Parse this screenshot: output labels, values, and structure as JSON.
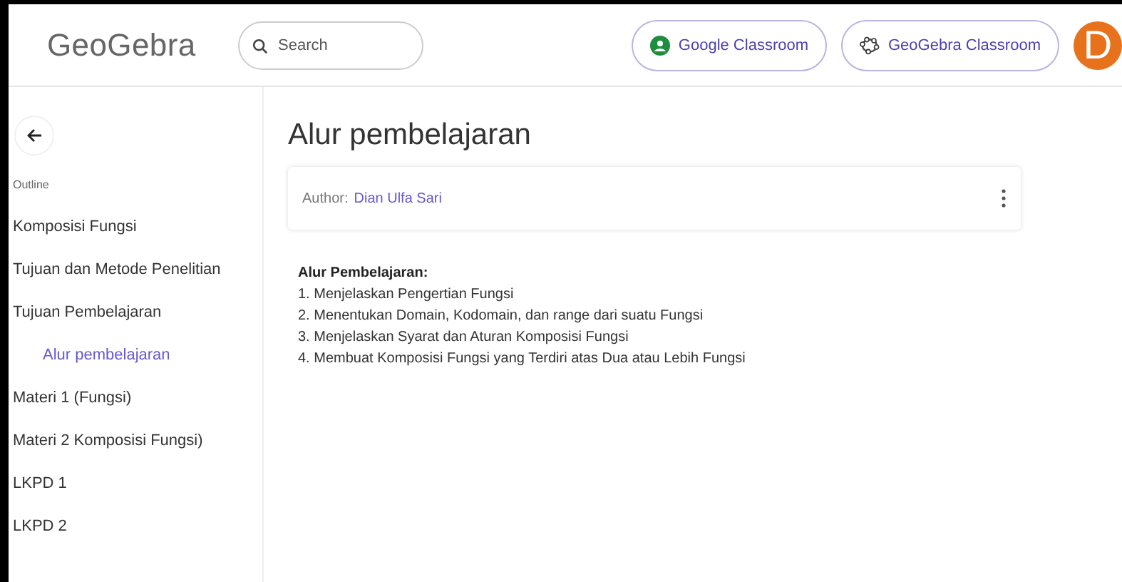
{
  "header": {
    "logo": "GeoGebra",
    "search": {
      "placeholder": "Search"
    },
    "buttons": [
      {
        "label": "Google Classroom",
        "kind": "google"
      },
      {
        "label": "GeoGebra Classroom",
        "kind": "geogebra"
      }
    ],
    "avatar": "D"
  },
  "sidebar": {
    "heading": "Outline",
    "items": [
      {
        "label": "Komposisi Fungsi",
        "selected": false
      },
      {
        "label": "Tujuan dan Metode Penelitian",
        "selected": false
      },
      {
        "label": "Tujuan Pembelajaran",
        "selected": false,
        "children": [
          {
            "label": "Alur pembelajaran",
            "selected": true
          }
        ]
      },
      {
        "label": "Materi 1 (Fungsi)",
        "selected": false
      },
      {
        "label": "Materi 2 Komposisi Fungsi)",
        "selected": false
      },
      {
        "label": "LKPD 1",
        "selected": false
      },
      {
        "label": "LKPD 2",
        "selected": false
      }
    ]
  },
  "page": {
    "title": "Alur pembelajaran",
    "author_label": "Author:",
    "author": "Dian Ulfa Sari",
    "content": {
      "heading": "Alur Pembelajaran:",
      "lines": [
        "1. Menjelaskan Pengertian Fungsi",
        "2. Menentukan Domain, Kodomain, dan range dari suatu Fungsi",
        "3. Menjelaskan Syarat dan Aturan Komposisi Fungsi",
        "4. Membuat Komposisi Fungsi yang Terdiri atas Dua atau Lebih Fungsi"
      ]
    }
  }
}
